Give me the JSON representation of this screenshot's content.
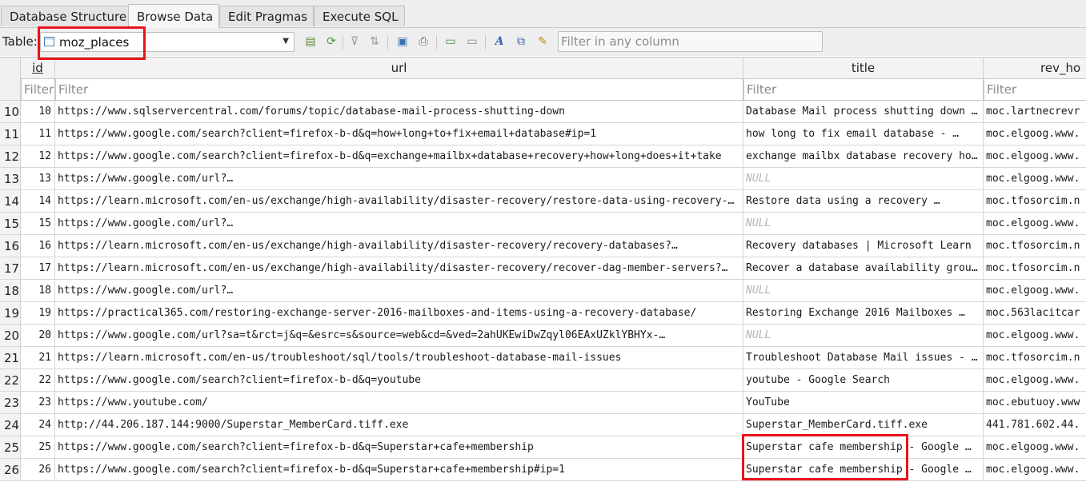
{
  "tabs": [
    "Database Structure",
    "Browse Data",
    "Edit Pragmas",
    "Execute SQL"
  ],
  "toolbar": {
    "table_label": "Table:",
    "table_value": "moz_places",
    "filter_placeholder": "Filter in any column",
    "icons": [
      "open-table-icon",
      "refresh-icon",
      "clear-filters-icon",
      "sort-icon",
      "save-table-icon",
      "print-icon",
      "insert-record-icon",
      "delete-record-icon",
      "text-format-icon",
      "encoding-icon",
      "settings-icon"
    ]
  },
  "columns": [
    "id",
    "url",
    "title",
    "rev_ho"
  ],
  "filter_placeholder": "Filter",
  "null_text": "NULL",
  "rows": [
    {
      "rownum": "10",
      "id": "10",
      "url": "https://www.sqlservercentral.com/forums/topic/database-mail-process-shutting-down",
      "title": "Database Mail process shutting down …",
      "rev_host": "moc.lartnecrevr"
    },
    {
      "rownum": "11",
      "id": "11",
      "url": "https://www.google.com/search?client=firefox-b-d&q=how+long+to+fix+email+database#ip=1",
      "title": "how long to fix email database - …",
      "rev_host": "moc.elgoog.www."
    },
    {
      "rownum": "12",
      "id": "12",
      "url": "https://www.google.com/search?client=firefox-b-d&q=exchange+mailbx+database+recovery+how+long+does+it+take",
      "title": "exchange mailbx database recovery ho…",
      "rev_host": "moc.elgoog.www."
    },
    {
      "rownum": "13",
      "id": "13",
      "url": "https://www.google.com/url?…",
      "title": "NULL",
      "rev_host": "moc.elgoog.www."
    },
    {
      "rownum": "14",
      "id": "14",
      "url": "https://learn.microsoft.com/en-us/exchange/high-availability/disaster-recovery/restore-data-using-recovery-…",
      "title": "Restore data using a recovery …",
      "rev_host": "moc.tfosorcim.n"
    },
    {
      "rownum": "15",
      "id": "15",
      "url": "https://www.google.com/url?…",
      "title": "NULL",
      "rev_host": "moc.elgoog.www."
    },
    {
      "rownum": "16",
      "id": "16",
      "url": "https://learn.microsoft.com/en-us/exchange/high-availability/disaster-recovery/recovery-databases?…",
      "title": "Recovery databases | Microsoft Learn",
      "rev_host": "moc.tfosorcim.n"
    },
    {
      "rownum": "17",
      "id": "17",
      "url": "https://learn.microsoft.com/en-us/exchange/high-availability/disaster-recovery/recover-dag-member-servers?…",
      "title": "Recover a database availability grou…",
      "rev_host": "moc.tfosorcim.n"
    },
    {
      "rownum": "18",
      "id": "18",
      "url": "https://www.google.com/url?…",
      "title": "NULL",
      "rev_host": "moc.elgoog.www."
    },
    {
      "rownum": "19",
      "id": "19",
      "url": "https://practical365.com/restoring-exchange-server-2016-mailboxes-and-items-using-a-recovery-database/",
      "title": "Restoring Exchange 2016 Mailboxes …",
      "rev_host": "moc.563lacitcar"
    },
    {
      "rownum": "20",
      "id": "20",
      "url": "https://www.google.com/url?sa=t&rct=j&q=&esrc=s&source=web&cd=&ved=2ahUKEwiDwZqyl06EAxUZklYBHYx-…",
      "title": "NULL",
      "rev_host": "moc.elgoog.www."
    },
    {
      "rownum": "21",
      "id": "21",
      "url": "https://learn.microsoft.com/en-us/troubleshoot/sql/tools/troubleshoot-database-mail-issues",
      "title": "Troubleshoot Database Mail issues - …",
      "rev_host": "moc.tfosorcim.n"
    },
    {
      "rownum": "22",
      "id": "22",
      "url": "https://www.google.com/search?client=firefox-b-d&q=youtube",
      "title": "youtube - Google Search",
      "rev_host": "moc.elgoog.www."
    },
    {
      "rownum": "23",
      "id": "23",
      "url": "https://www.youtube.com/",
      "title": "YouTube",
      "rev_host": "moc.ebutuoy.www"
    },
    {
      "rownum": "24",
      "id": "24",
      "url": "http://44.206.187.144:9000/Superstar_MemberCard.tiff.exe",
      "title": "Superstar_MemberCard.tiff.exe",
      "rev_host": "441.781.602.44."
    },
    {
      "rownum": "25",
      "id": "25",
      "url": "https://www.google.com/search?client=firefox-b-d&q=Superstar+cafe+membership",
      "title": "Superstar cafe membership - Google …",
      "rev_host": "moc.elgoog.www."
    },
    {
      "rownum": "26",
      "id": "26",
      "url": "https://www.google.com/search?client=firefox-b-d&q=Superstar+cafe+membership#ip=1",
      "title": "Superstar cafe membership - Google …",
      "rev_host": "moc.elgoog.www."
    }
  ],
  "colors": {
    "highlight": "#e8141c"
  }
}
